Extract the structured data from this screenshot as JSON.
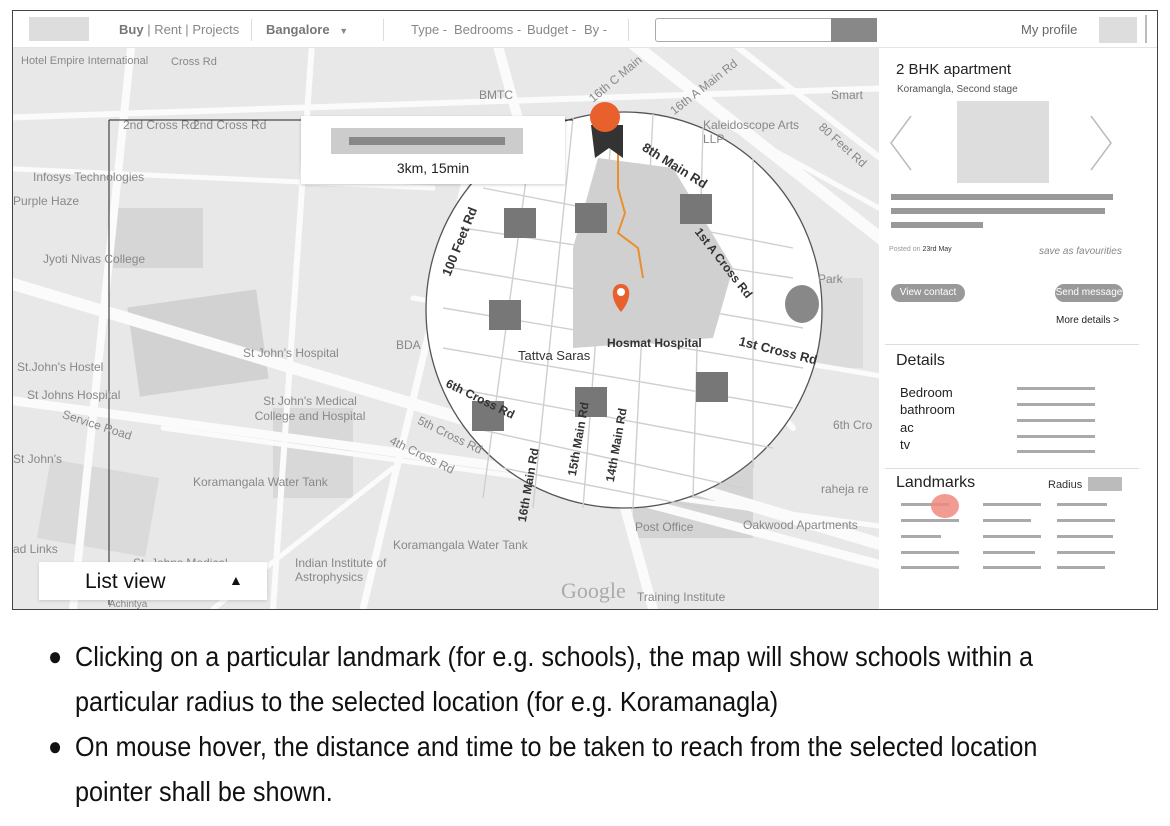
{
  "nav": {
    "buy": "Buy",
    "rent": "Rent",
    "projects": "Projects",
    "city": "Bangalore",
    "filters": [
      "Type",
      "Bedrooms",
      "Budget",
      "By"
    ],
    "search_placeholder": "",
    "profile": "My profile"
  },
  "map": {
    "labels": [
      "Hotel Empire International",
      "Cross Rd",
      "2nd Cross Rd",
      "2nd Cross Rd",
      "BMTC",
      "16th C Main",
      "16th A Main Rd",
      "Smart",
      "Kaleidoscope Arts LLP",
      "80 Feet Rd",
      "8th Main Rd",
      "Infosys Technologies",
      "Purple Haze",
      "100 Feet Rd",
      "1st A Cross Rd",
      "Jyoti Nivas College",
      "Park",
      "BDA",
      "Tattva Saras",
      "Hosmat Hospital",
      "1st Cross Rd",
      "St John's Hospital",
      "St.John's Hostel",
      "St Johns Hospital",
      "St John's Medical College and Hospital",
      "Service Road",
      "5th Cross Rd",
      "4th Cross Rd",
      "6th Cross Rd",
      "16th Main Rd",
      "15th Main Rd",
      "14th Main Rd",
      "6th Cro",
      "St John's",
      "Koramangala Water Tank",
      "raheja re",
      "Post Office",
      "Oakwood Apartments",
      "Indian Institute of Astrophysics",
      "Koramangala Water Tank",
      "Training Institute",
      "St. Johns Medical",
      "ad Links",
      "Achintya",
      "Google"
    ],
    "info_card": {
      "text": "3km, 15min"
    },
    "list_view": "List view",
    "list_view_arrow": "▲",
    "colors": {
      "accent": "#e8602c",
      "highlight": "#f08a80"
    }
  },
  "panel": {
    "title": "2 BHK apartment",
    "subtitle": "Koramangla, Second stage",
    "posted_prefix": "Posted on",
    "posted_date": "23rd May",
    "favourite": "save as favourities",
    "view_contact": "View contact",
    "send_message": "Send message",
    "more_details": "More details >",
    "details_heading": "Details",
    "details": [
      "Bedroom",
      "bathroom",
      "ac",
      "tv"
    ],
    "landmarks_heading": "Landmarks",
    "radius_label": "Radius"
  },
  "notes": [
    "Clicking on a particular landmark (for e.g. schools), the map will show schools within a particular radius to the selected location (for e.g. Koramanagla)",
    "On mouse hover, the distance and time to be taken to reach from the selected location pointer shall be shown."
  ]
}
